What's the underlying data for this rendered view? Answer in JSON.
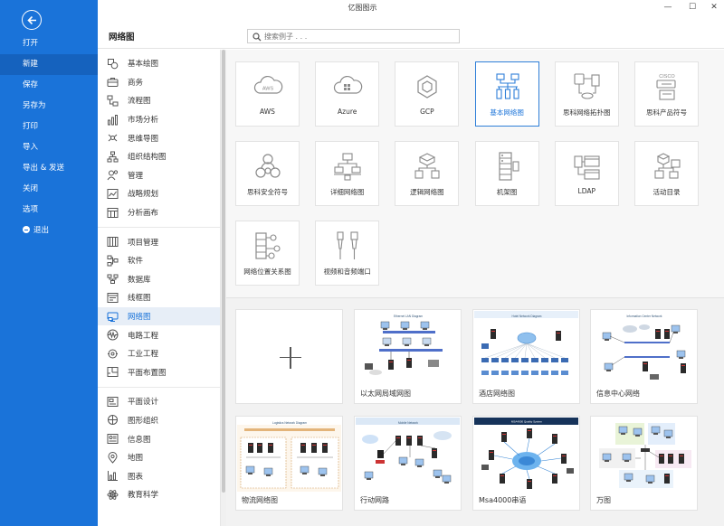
{
  "window": {
    "title": "亿图图示",
    "minimize": "—",
    "maximize": "☐",
    "close": "✕"
  },
  "sidebar": {
    "items": [
      {
        "label": "打开"
      },
      {
        "label": "新建",
        "active": true
      },
      {
        "label": "保存"
      },
      {
        "label": "另存为"
      },
      {
        "label": "打印"
      },
      {
        "label": "导入"
      },
      {
        "label": "导出 & 发送"
      },
      {
        "label": "关闭"
      },
      {
        "label": "选项"
      },
      {
        "label": "退出"
      }
    ]
  },
  "header": {
    "title": "网络图",
    "search_placeholder": "搜索例子 . . ."
  },
  "categories": {
    "group1": [
      {
        "label": "基本绘图",
        "icon": "shapes-icon"
      },
      {
        "label": "商务",
        "icon": "briefcase-icon"
      },
      {
        "label": "流程图",
        "icon": "flowchart-icon"
      },
      {
        "label": "市场分析",
        "icon": "bar-chart-icon"
      },
      {
        "label": "思维导图",
        "icon": "mindmap-icon"
      },
      {
        "label": "组织结构图",
        "icon": "org-chart-icon"
      },
      {
        "label": "管理",
        "icon": "management-icon"
      },
      {
        "label": "战略规划",
        "icon": "strategy-icon"
      },
      {
        "label": "分析画布",
        "icon": "canvas-icon"
      }
    ],
    "group2": [
      {
        "label": "项目管理",
        "icon": "gantt-icon"
      },
      {
        "label": "软件",
        "icon": "software-icon"
      },
      {
        "label": "数据库",
        "icon": "database-icon"
      },
      {
        "label": "线框图",
        "icon": "wireframe-icon"
      },
      {
        "label": "网络图",
        "icon": "network-icon",
        "active": true
      },
      {
        "label": "电路工程",
        "icon": "circuit-icon"
      },
      {
        "label": "工业工程",
        "icon": "industrial-icon"
      },
      {
        "label": "平面布置图",
        "icon": "floorplan-icon"
      }
    ],
    "group3": [
      {
        "label": "平面设计",
        "icon": "graphic-design-icon"
      },
      {
        "label": "图形组织",
        "icon": "graphic-organizer-icon"
      },
      {
        "label": "信息图",
        "icon": "infographic-icon"
      },
      {
        "label": "地图",
        "icon": "map-pin-icon"
      },
      {
        "label": "图表",
        "icon": "chart-icon"
      },
      {
        "label": "教育科学",
        "icon": "science-icon"
      }
    ]
  },
  "templates": [
    {
      "label": "AWS",
      "icon": "aws-cloud-icon"
    },
    {
      "label": "Azure",
      "icon": "azure-cloud-icon"
    },
    {
      "label": "GCP",
      "icon": "gcp-hexagon-icon"
    },
    {
      "label": "基本网络图",
      "icon": "basic-network-icon",
      "selected": true
    },
    {
      "label": "思科网络拓扑图",
      "icon": "cisco-topology-icon"
    },
    {
      "label": "思科产品符号",
      "icon": "cisco-product-icon",
      "badge": "CISCO"
    },
    {
      "label": "思科安全符号",
      "icon": "cisco-security-icon"
    },
    {
      "label": "详细网络图",
      "icon": "detailed-network-icon"
    },
    {
      "label": "逻辑网络图",
      "icon": "logical-network-icon"
    },
    {
      "label": "机架图",
      "icon": "rack-icon"
    },
    {
      "label": "LDAP",
      "icon": "ldap-icon"
    },
    {
      "label": "活动目录",
      "icon": "active-directory-icon"
    },
    {
      "label": "网络位置关系图",
      "icon": "network-location-icon"
    },
    {
      "label": "视频和音频端口",
      "icon": "av-ports-icon"
    }
  ],
  "examples": [
    {
      "label": "以太网局域网图",
      "thumb_title": "Ethernet LAN Diagram"
    },
    {
      "label": "酒店网络图",
      "thumb_title": "Hotel Network Diagram"
    },
    {
      "label": "信息中心网络",
      "thumb_title": "Information Center Network"
    },
    {
      "label": "物流网络图",
      "thumb_title": "Logistics Network Diagram"
    },
    {
      "label": "行动网路",
      "thumb_title": "Mobile Network"
    },
    {
      "label": "Msa4000串语",
      "thumb_title": "MSA4000 Quality System"
    },
    {
      "label": "万图",
      "thumb_title": ""
    }
  ],
  "colors": {
    "sidebar_bg": "#1a73d9",
    "accent": "#1a73d9",
    "selected_border": "#2e7fd8"
  }
}
